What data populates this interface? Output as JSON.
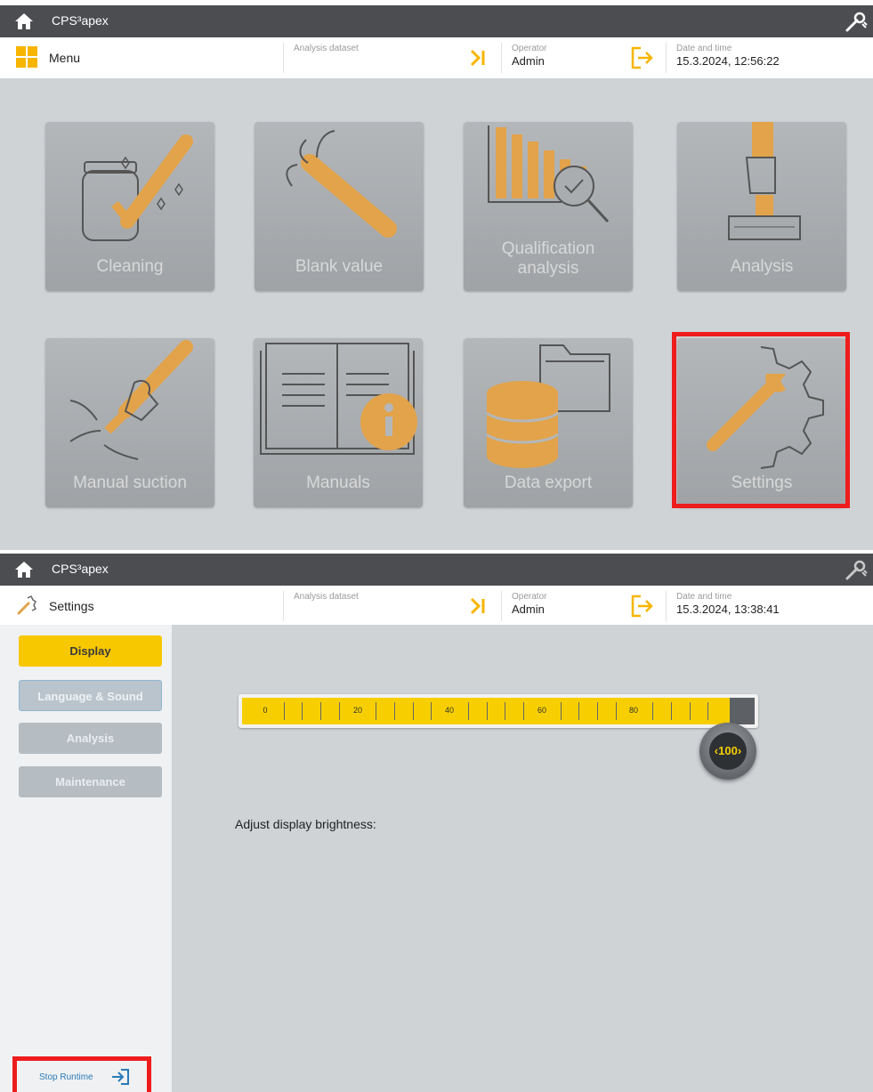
{
  "colors": {
    "accent": "#f7c800",
    "highlight": "#ee1c1c",
    "titlebar": "#4b4d50"
  },
  "screen1": {
    "app_title": "CPS³apex",
    "page_label": "Menu",
    "analysis_dataset_label": "Analysis dataset",
    "operator_label": "Operator",
    "operator_value": "Admin",
    "datetime_label": "Date and time",
    "datetime_value": "15.3.2024, 12:56:22",
    "tiles": [
      {
        "label": "Cleaning",
        "icon": "cleaning-icon"
      },
      {
        "label": "Blank value",
        "icon": "blank-value-icon"
      },
      {
        "label": "Qualification analysis",
        "icon": "qualification-analysis-icon"
      },
      {
        "label": "Analysis",
        "icon": "analysis-icon"
      },
      {
        "label": "Manual suction",
        "icon": "manual-suction-icon"
      },
      {
        "label": "Manuals",
        "icon": "manuals-icon"
      },
      {
        "label": "Data export",
        "icon": "data-export-icon"
      },
      {
        "label": "Settings",
        "icon": "settings-icon"
      }
    ]
  },
  "screen2": {
    "app_title": "CPS³apex",
    "page_label": "Settings",
    "analysis_dataset_label": "Analysis dataset",
    "operator_label": "Operator",
    "operator_value": "Admin",
    "datetime_label": "Date and time",
    "datetime_value": "15.3.2024, 13:38:41",
    "sidebar": [
      {
        "label": "Display",
        "state": "active"
      },
      {
        "label": "Language & Sound",
        "state": "focused"
      },
      {
        "label": "Analysis",
        "state": "inactive"
      },
      {
        "label": "Maintenance",
        "state": "inactive"
      }
    ],
    "brightness_label": "Adjust display brightness:",
    "brightness_ticks": [
      "0",
      "20",
      "40",
      "60",
      "80"
    ],
    "brightness_value": "100",
    "brightness_fraction": 1.0,
    "stop_runtime_label": "Stop Runtime"
  }
}
